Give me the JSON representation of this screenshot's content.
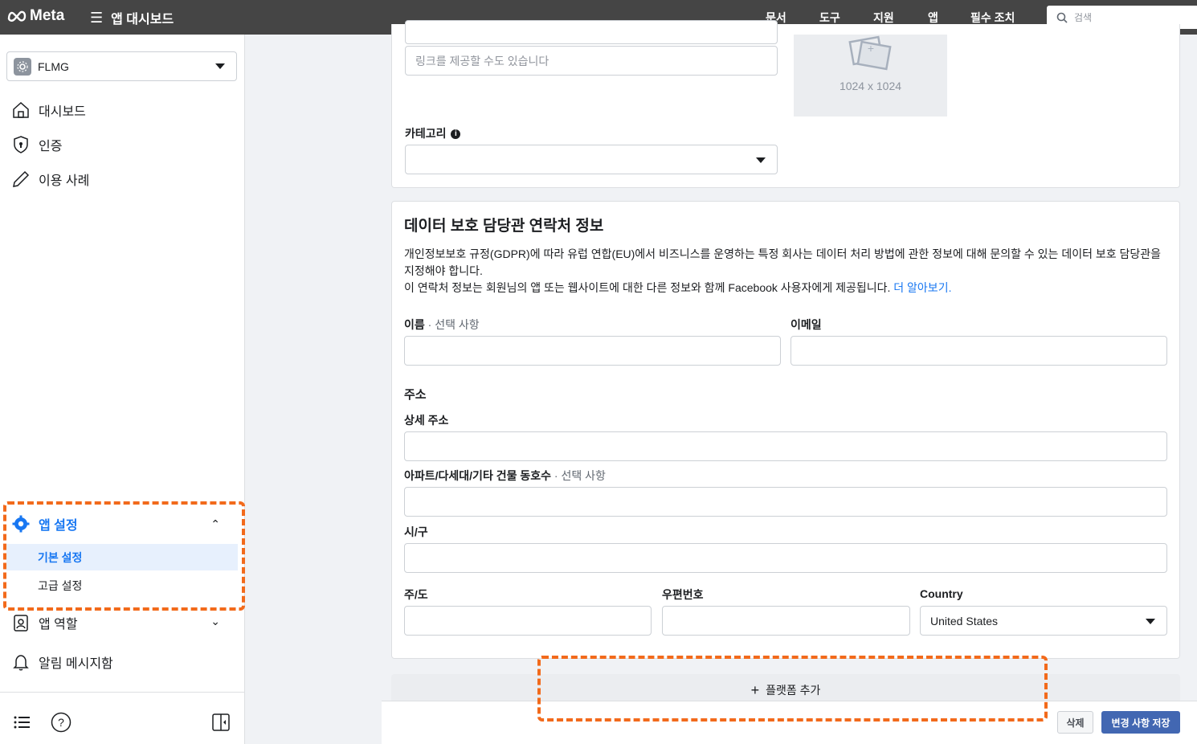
{
  "topbar": {
    "brand": "Meta",
    "menu_label": "앱 대시보드",
    "nav": [
      "문서",
      "도구",
      "지원",
      "앱",
      "필수 조치"
    ],
    "search_placeholder": "검색"
  },
  "sidebar": {
    "app_name": "FLMG",
    "items": [
      {
        "label": "대시보드",
        "icon": "home-icon"
      },
      {
        "label": "인증",
        "icon": "shield-icon"
      },
      {
        "label": "이용 사례",
        "icon": "pencil-icon"
      }
    ],
    "app_settings": {
      "label": "앱 설정",
      "sub": [
        "기본 설정",
        "고급 설정"
      ]
    },
    "app_roles": "앱 역할",
    "notifications": "알림 메시지함"
  },
  "top_card": {
    "link_placeholder": "링크를 제공할 수도 있습니다",
    "image_size": "1024 x 1024",
    "category_label": "카테고리"
  },
  "dpo": {
    "title": "데이터 보호 담당관 연락처 정보",
    "desc_line1": "개인정보보호 규정(GDPR)에 따라 유럽 연합(EU)에서 비즈니스를 운영하는 특정 회사는 데이터 처리 방법에 관한 정보에 대해 문의할 수 있는 데이터 보호 담당관을 지정해야 합니다.",
    "desc_line2": "이 연락처 정보는 회원님의 앱 또는 웹사이트에 대한 다른 정보와 함께 Facebook 사용자에게 제공됩니다.",
    "learn_more": "더 알아보기.",
    "name_label": "이름",
    "optional": "· 선택 사항",
    "email_label": "이메일",
    "address_title": "주소",
    "street_label": "상세 주소",
    "apt_label": "아파트/다세대/기타 건물 동호수",
    "city_label": "시/구",
    "state_label": "주/도",
    "zip_label": "우편번호",
    "country_label": "Country",
    "country_value": "United States"
  },
  "actions": {
    "add_platform": "플랫폼 추가",
    "delete": "삭제",
    "save": "변경 사항 저장"
  },
  "colors": {
    "accent": "#1877f2",
    "highlight": "#f26a1b",
    "save_button": "#4267b2"
  }
}
